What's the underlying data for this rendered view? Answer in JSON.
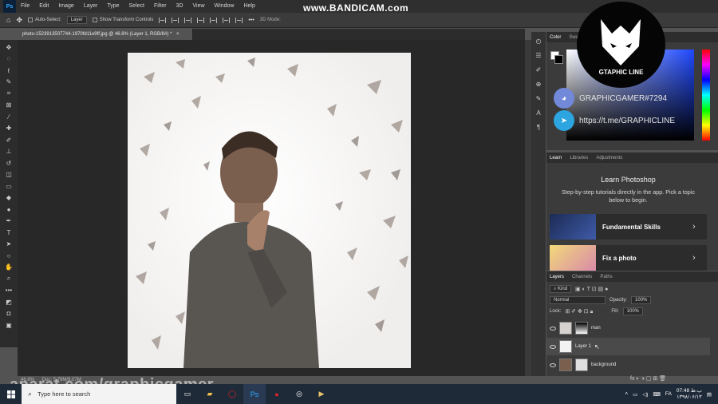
{
  "menubar": {
    "logo": "Ps",
    "items": [
      "File",
      "Edit",
      "Image",
      "Layer",
      "Type",
      "Select",
      "Filter",
      "3D",
      "View",
      "Window",
      "Help"
    ]
  },
  "options": {
    "auto_select_label": "Auto-Select:",
    "auto_select_value": "Layer",
    "transform_controls_label": "Show Transform Controls",
    "mode_3d": "3D Mode:"
  },
  "recorder_watermark": "www.BANDICAM.com",
  "document": {
    "tab_title": "photo-1523913507744-1970fd11e9ff.jpg @ 46.8% (Layer 1, RGB/8#) *",
    "close": "×",
    "zoom_status": "46.8%",
    "doc_status": "Doc: 5.79M/9.07M"
  },
  "panels": {
    "color_tabs": [
      "Color",
      "Swatches"
    ],
    "learn_tabs": [
      "Learn",
      "Libraries",
      "Adjustments"
    ],
    "learn_title": "Learn Photoshop",
    "learn_desc": "Step-by-step tutorials directly in the app. Pick a topic below to begin.",
    "learn_cards": [
      {
        "label": "Fundamental Skills",
        "chev": "›"
      },
      {
        "label": "Fix a photo",
        "chev": "›"
      }
    ],
    "layers_tabs": [
      "Layers",
      "Channels",
      "Paths"
    ],
    "kind_filter": "Kind",
    "blend_mode": "Normal",
    "opacity_label": "Opacity:",
    "opacity_value": "100%",
    "lock_label": "Lock:",
    "fill_label": "Fill:",
    "fill_value": "100%",
    "layers": [
      {
        "name": "man",
        "selected": false
      },
      {
        "name": "Layer 1",
        "selected": true
      },
      {
        "name": "background",
        "selected": false
      }
    ]
  },
  "channel_overlay": {
    "logo_text": "GTAPHIC LINE",
    "discord": "GRAPHICGAMER#7294",
    "telegram": "https://t.me/GRAPHICLINE"
  },
  "footer_watermark": "aparat.com/graphicgamer",
  "taskbar": {
    "search_placeholder": "Type here to search",
    "time": "07:48 ب.ظ",
    "date": "۱۳۹۸/۰۶/۱۳",
    "lang": "FA"
  },
  "colors": {
    "foreground": "#ffffff",
    "background": "#000000",
    "accent": "#31a8ff"
  }
}
